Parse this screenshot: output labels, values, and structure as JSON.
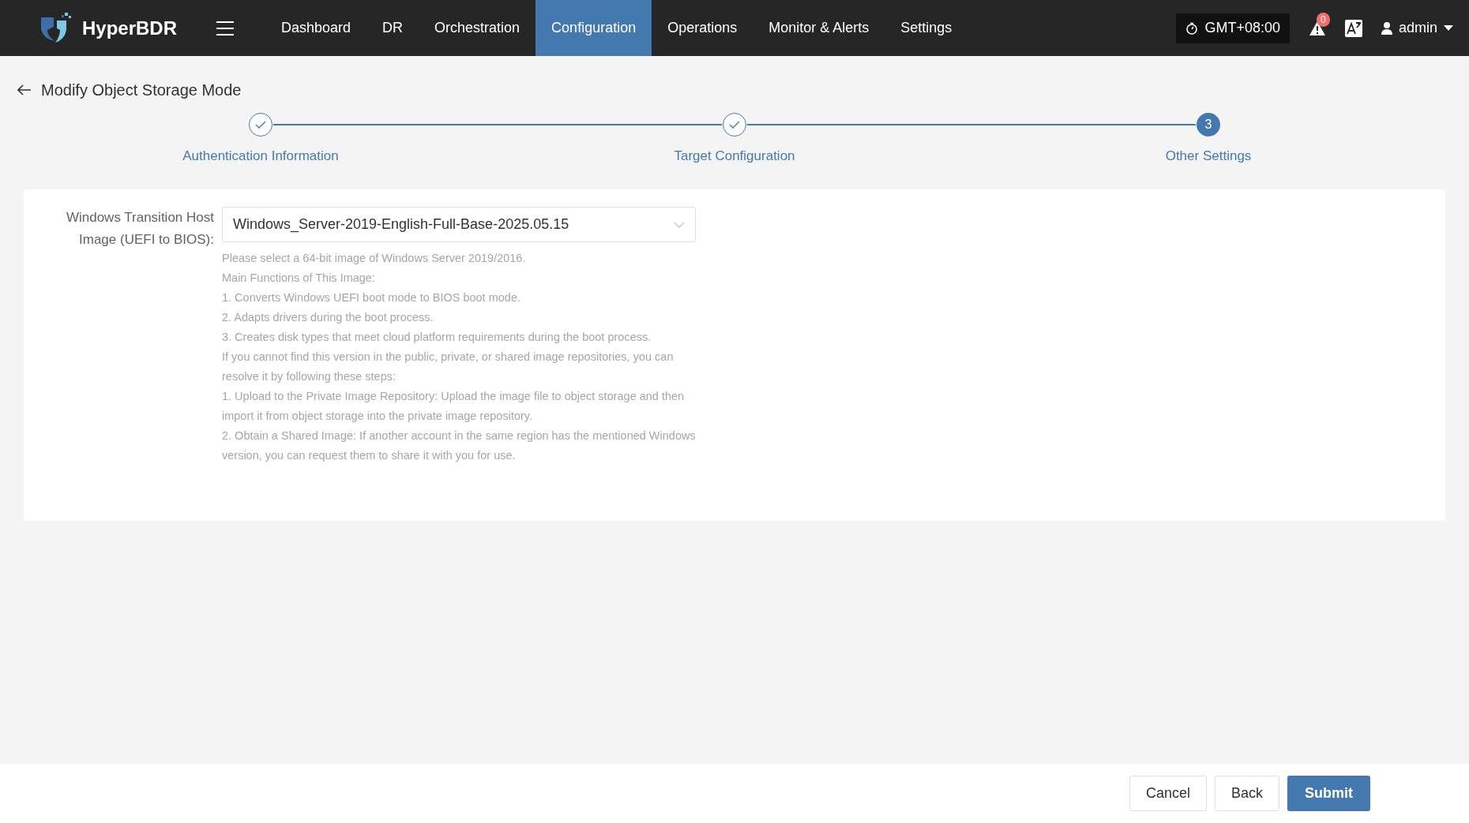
{
  "brand": "HyperBDR",
  "nav": [
    {
      "label": "Dashboard",
      "selected": false
    },
    {
      "label": "DR",
      "selected": false
    },
    {
      "label": "Orchestration",
      "selected": false
    },
    {
      "label": "Configuration",
      "selected": true
    },
    {
      "label": "Operations",
      "selected": false
    },
    {
      "label": "Monitor & Alerts",
      "selected": false
    },
    {
      "label": "Settings",
      "selected": false
    }
  ],
  "timezone": "GMT+08:00",
  "alert_count": "0",
  "user": "admin",
  "page_title": "Modify Object Storage Mode",
  "steps": [
    {
      "label": "Authentication Information",
      "completed": true
    },
    {
      "label": "Target Configuration",
      "completed": true
    },
    {
      "label": "Other Settings",
      "completed": false,
      "number": "3"
    }
  ],
  "form": {
    "label": "Windows Transition Host Image (UEFI to BIOS):",
    "value": "Windows_Server-2019-English-Full-Base-2025.05.15",
    "help": [
      "Please select a 64-bit image of Windows Server 2019/2016.",
      "Main Functions of This Image:",
      "1. Converts Windows UEFI boot mode to BIOS boot mode.",
      "2. Adapts drivers during the boot process.",
      "3. Creates disk types that meet cloud platform requirements during the boot process.",
      "If you cannot find this version in the public, private, or shared image repositories, you can resolve it by following these steps:",
      "1. Upload to the Private Image Repository: Upload the image file to object storage and then import it from object storage into the private image repository.",
      "2. Obtain a Shared Image: If another account in the same region has the mentioned Windows version, you can request them to share it with you for use."
    ]
  },
  "buttons": [
    {
      "label": "Cancel",
      "kind": "default"
    },
    {
      "label": "Back",
      "kind": "default"
    },
    {
      "label": "Submit",
      "kind": "primary"
    }
  ]
}
